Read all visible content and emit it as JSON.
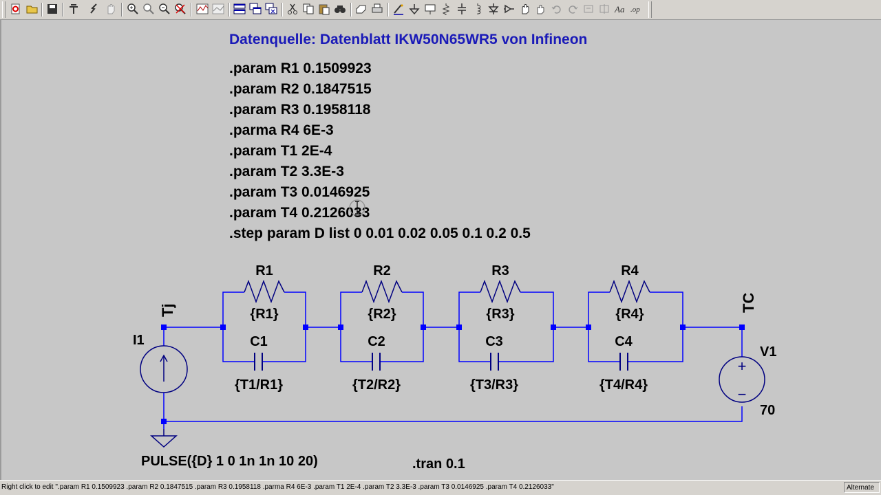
{
  "toolbar": {
    "icons": [
      "new-schematic-icon",
      "open-icon",
      "save-icon",
      "control-panel-icon",
      "run-icon",
      "halt-icon",
      "zoom-in-icon",
      "zoom-pan-icon",
      "zoom-out-icon",
      "zoom-cancel-icon",
      "waveform-icon",
      "autorange-icon",
      "tile-windows-icon",
      "cascade-windows-icon",
      "close-windows-icon",
      "cut-icon",
      "copy-icon",
      "paste-icon",
      "find-icon",
      "print-setup-icon",
      "print-icon",
      "draw-wire-icon",
      "ground-icon",
      "label-net-icon",
      "resistor-icon",
      "capacitor-icon",
      "inductor-icon",
      "diode-icon",
      "component-icon",
      "move-icon",
      "drag-icon",
      "undo-icon",
      "redo-icon",
      "rotate-icon",
      "mirror-icon",
      "text-icon",
      "spice-directive-icon"
    ]
  },
  "directives": {
    "title": "Datenquelle: Datenblatt IKW50N65WR5 von Infineon",
    "lines": [
      ".param R1 0.1509923",
      ".param R2 0.1847515",
      ".param R3 0.1958118",
      ".parma R4 6E-3",
      ".param T1 2E-4",
      ".param T2 3.3E-3",
      ".param T3 0.0146925",
      ".param T4 0.2126033",
      ".step param D list 0 0.01 0.02 0.05 0.1 0.2 0.5"
    ],
    "tran": ".tran 0.1"
  },
  "nets": {
    "tj": "Tj",
    "tc": "TC"
  },
  "resistors": [
    {
      "name": "R1",
      "value": "{R1}"
    },
    {
      "name": "R2",
      "value": "{R2}"
    },
    {
      "name": "R3",
      "value": "{R3}"
    },
    {
      "name": "R4",
      "value": "{R4}"
    }
  ],
  "capacitors": [
    {
      "name": "C1",
      "value": "{T1/R1}"
    },
    {
      "name": "C2",
      "value": "{T2/R2}"
    },
    {
      "name": "C3",
      "value": "{T3/R3}"
    },
    {
      "name": "C4",
      "value": "{T4/R4}"
    }
  ],
  "current_source": {
    "name": "I1",
    "value": "PULSE({D} 1 0 1n 1n 10 20)"
  },
  "voltage_source": {
    "name": "V1",
    "value": "70",
    "plus": "+",
    "minus": "−"
  },
  "status": {
    "text": "Right click to edit \".param R1 0.1509923  .param R2 0.1847515  .param R3 0.1958118  .parma R4 6E-3  .param T1 2E-4  .param T2 3.3E-3  .param T3 0.0146925  .param T4 0.2126033\"",
    "mode": "Alternate"
  },
  "colors": {
    "wire": "#0000ff",
    "component": "#000080",
    "title": "#1a1ab8",
    "junction": "#0000ff"
  }
}
